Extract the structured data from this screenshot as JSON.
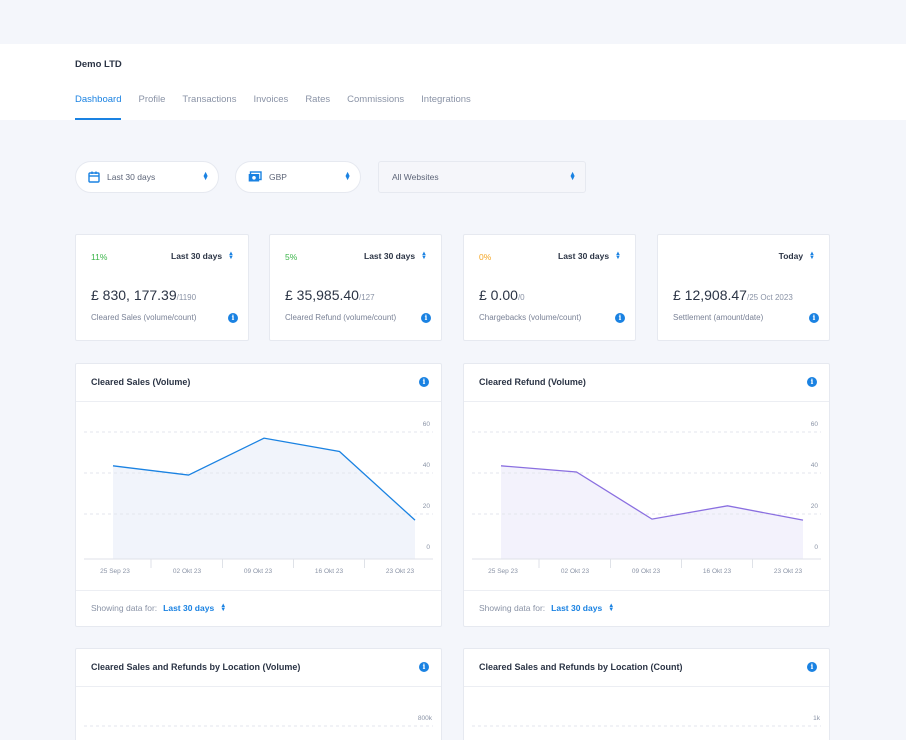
{
  "company": "Demo LTD",
  "tabs": [
    "Dashboard",
    "Profile",
    "Transactions",
    "Invoices",
    "Rates",
    "Commissions",
    "Integrations"
  ],
  "active_tab": "Dashboard",
  "filters": {
    "period": {
      "label": "Last 30 days",
      "icon": "calendar-icon"
    },
    "currency": {
      "label": "GBP",
      "icon": "money-icon"
    },
    "website": {
      "label": "All Websites"
    }
  },
  "stats": [
    {
      "pct": "11%",
      "pct_color": "#3cb54a",
      "period": "Last 30 days",
      "value": "£ 830, 177.39",
      "sub": "/1190",
      "desc": "Cleared Sales (volume/count)"
    },
    {
      "pct": "5%",
      "pct_color": "#3cb54a",
      "period": "Last 30 days",
      "value": "£ 35,985.40",
      "sub": "/127",
      "desc": "Cleared Refund (volume/count)"
    },
    {
      "pct": "0%",
      "pct_color": "#f5a623",
      "period": "Last 30 days",
      "value": "£ 0.00",
      "sub": "/0",
      "desc": "Chargebacks (volume/count)"
    },
    {
      "pct": "",
      "pct_color": "#3cb54a",
      "period": "Today",
      "value": "£ 12,908.47",
      "sub": "/25 Oct 2023",
      "desc": "Settlement (amount/date)"
    }
  ],
  "colors": {
    "accent": "#1a82e2",
    "refund_line": "#8a6fe0"
  },
  "charts": [
    {
      "title": "Cleared Sales (Volume)",
      "footer_label": "Showing data for:",
      "footer_value": "Last 30 days"
    },
    {
      "title": "Cleared Refund (Volume)",
      "footer_label": "Showing data for:",
      "footer_value": "Last 30 days"
    }
  ],
  "chart_data": [
    {
      "type": "area",
      "title": "Cleared Sales (Volume)",
      "categories": [
        "25 Sep 23",
        "02 Okt 23",
        "09 Okt 23",
        "16 Okt 23",
        "23 Okt 23"
      ],
      "values": [
        43.5,
        39,
        57,
        50.5,
        17
      ],
      "yticks": [
        "60",
        "40",
        "20",
        "0"
      ],
      "ylim": [
        -2,
        65
      ],
      "color": "#1a82e2",
      "fill": "#f1f4fb"
    },
    {
      "type": "area",
      "title": "Cleared Refund (Volume)",
      "categories": [
        "25 Sep 23",
        "02 Okt 23",
        "09 Okt 23",
        "16 Okt 23",
        "23 Okt 23"
      ],
      "values": [
        43.5,
        40.5,
        17.5,
        24,
        17
      ],
      "yticks": [
        "60",
        "40",
        "20",
        "0"
      ],
      "ylim": [
        -2,
        65
      ],
      "color": "#8a6fe0",
      "fill": "#f3f2fc"
    }
  ],
  "location_charts": [
    {
      "title": "Cleared Sales and Refunds by Location (Volume)",
      "ytick": "800k"
    },
    {
      "title": "Cleared Sales and Refunds by Location (Count)",
      "ytick": "1k"
    }
  ]
}
